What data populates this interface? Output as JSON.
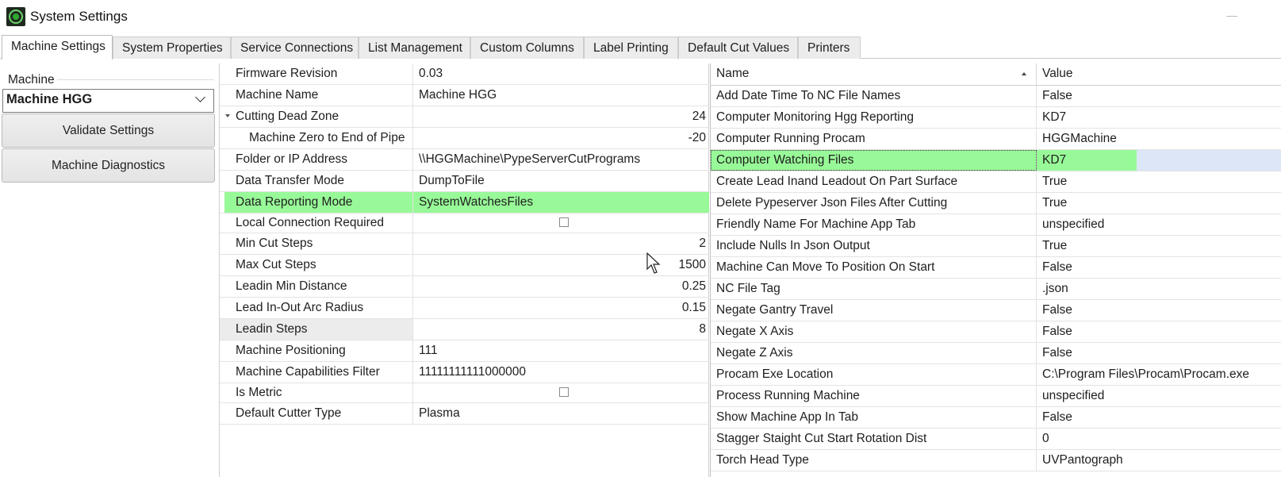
{
  "window": {
    "title": "System Settings"
  },
  "tabs": [
    {
      "label": "Machine Settings"
    },
    {
      "label": "System Properties"
    },
    {
      "label": "Service Connections"
    },
    {
      "label": "List Management"
    },
    {
      "label": "Custom Columns"
    },
    {
      "label": "Label Printing"
    },
    {
      "label": "Default Cut Values"
    },
    {
      "label": "Printers"
    }
  ],
  "active_tab": "Machine Settings",
  "left_panel": {
    "group_label": "Machine",
    "machine_selected": "Machine HGG",
    "validate_button": "Validate Settings",
    "diagnostics_button": "Machine Diagnostics"
  },
  "property_grid": [
    {
      "name": "Firmware Revision",
      "value": "0.03"
    },
    {
      "name": "Machine Name",
      "value": "Machine HGG"
    },
    {
      "name": "Cutting Dead Zone",
      "value": "24"
    },
    {
      "name": "Machine Zero to End of Pipe",
      "value": "-20"
    },
    {
      "name": "Folder or IP Address",
      "value": "\\\\HGGMachine\\PypeServerCutPrograms"
    },
    {
      "name": "Data Transfer Mode",
      "value": "DumpToFile"
    },
    {
      "name": "Data Reporting Mode",
      "value": "SystemWatchesFiles"
    },
    {
      "name": "Local Connection Required",
      "value": "",
      "checked": false
    },
    {
      "name": "Min Cut Steps",
      "value": "2"
    },
    {
      "name": "Max Cut Steps",
      "value": "1500"
    },
    {
      "name": "Leadin Min Distance",
      "value": "0.25"
    },
    {
      "name": "Lead In-Out Arc Radius",
      "value": "0.15"
    },
    {
      "name": "Leadin Steps",
      "value": "8"
    },
    {
      "name": "Machine Positioning",
      "value": "111"
    },
    {
      "name": "Machine Capabilities Filter",
      "value": "11111111111000000"
    },
    {
      "name": "Is Metric",
      "value": "",
      "checked": false
    },
    {
      "name": "Default Cutter Type",
      "value": "Plasma"
    }
  ],
  "right_grid": {
    "headers": {
      "name": "Name",
      "value": "Value"
    },
    "sort": "ascending",
    "selected_row": "Computer Watching Files",
    "rows": [
      {
        "name": "Add Date Time To NC File Names",
        "value": "False"
      },
      {
        "name": "Computer Monitoring Hgg Reporting",
        "value": "KD7"
      },
      {
        "name": "Computer Running Procam",
        "value": "HGGMachine"
      },
      {
        "name": "Computer Watching Files",
        "value": "KD7"
      },
      {
        "name": "Create Lead Inand Leadout On Part Surface",
        "value": "True"
      },
      {
        "name": "Delete Pypeserver Json Files After Cutting",
        "value": "True"
      },
      {
        "name": "Friendly Name For Machine App Tab",
        "value": "unspecified"
      },
      {
        "name": "Include Nulls In Json Output",
        "value": "True"
      },
      {
        "name": "Machine Can Move To Position On Start",
        "value": "False"
      },
      {
        "name": "NC File Tag",
        "value": ".json"
      },
      {
        "name": "Negate Gantry Travel",
        "value": "False"
      },
      {
        "name": "Negate X Axis",
        "value": "False"
      },
      {
        "name": "Negate Z Axis",
        "value": "False"
      },
      {
        "name": "Procam Exe Location",
        "value": "C:\\Program Files\\Procam\\Procam.exe"
      },
      {
        "name": "Process Running Machine",
        "value": "unspecified"
      },
      {
        "name": "Show Machine App In Tab",
        "value": "False"
      },
      {
        "name": "Stagger Staight Cut Start Rotation Dist",
        "value": "0"
      },
      {
        "name": "Torch Head Type",
        "value": "UVPantograph"
      }
    ]
  },
  "colors": {
    "highlight_green": "#98f998",
    "selection_blue": "#dde6f7"
  }
}
